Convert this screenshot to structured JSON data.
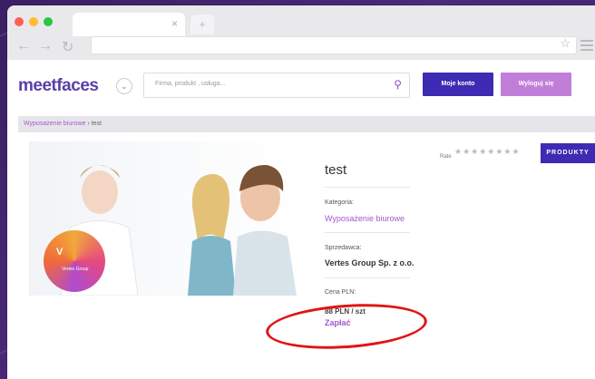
{
  "browser": {
    "tab_close": "×",
    "new_tab": "+",
    "back": "←",
    "forward": "→",
    "reload": "↻",
    "bookmark": "☆",
    "dots": [
      "#ff5f57",
      "#febc2e",
      "#28c840"
    ]
  },
  "header": {
    "logo": "meetfaces",
    "dropdown_icon": "⌄",
    "search_placeholder": "Firma, produkt , usługa...",
    "search_icon": "🔍",
    "account_button": "Moje konto",
    "logout_button": "Wyloguj się"
  },
  "breadcrumb": {
    "category": "Wyposażenie biurowe",
    "separator": "›",
    "current": "test"
  },
  "product": {
    "title": "test",
    "category_label": "Kategoria:",
    "category_value": "Wyposażenie biurowe",
    "seller_label": "Sprzedawca:",
    "seller_value": "Vertes Group Sp. z o.o.",
    "price_label": "Cena PLN:",
    "price_value": "88 PLN / szt",
    "pay_link": "Zapłać",
    "badge_text": "Vertes Group"
  },
  "rating": {
    "label": "Rate",
    "stars": "★★★★★★★★"
  },
  "products_button": "PRODUKTY",
  "colors": {
    "brand_primary": "#3d2bb3",
    "brand_accent": "#c17ed9",
    "link": "#a557cf",
    "highlight": "#e01515"
  }
}
